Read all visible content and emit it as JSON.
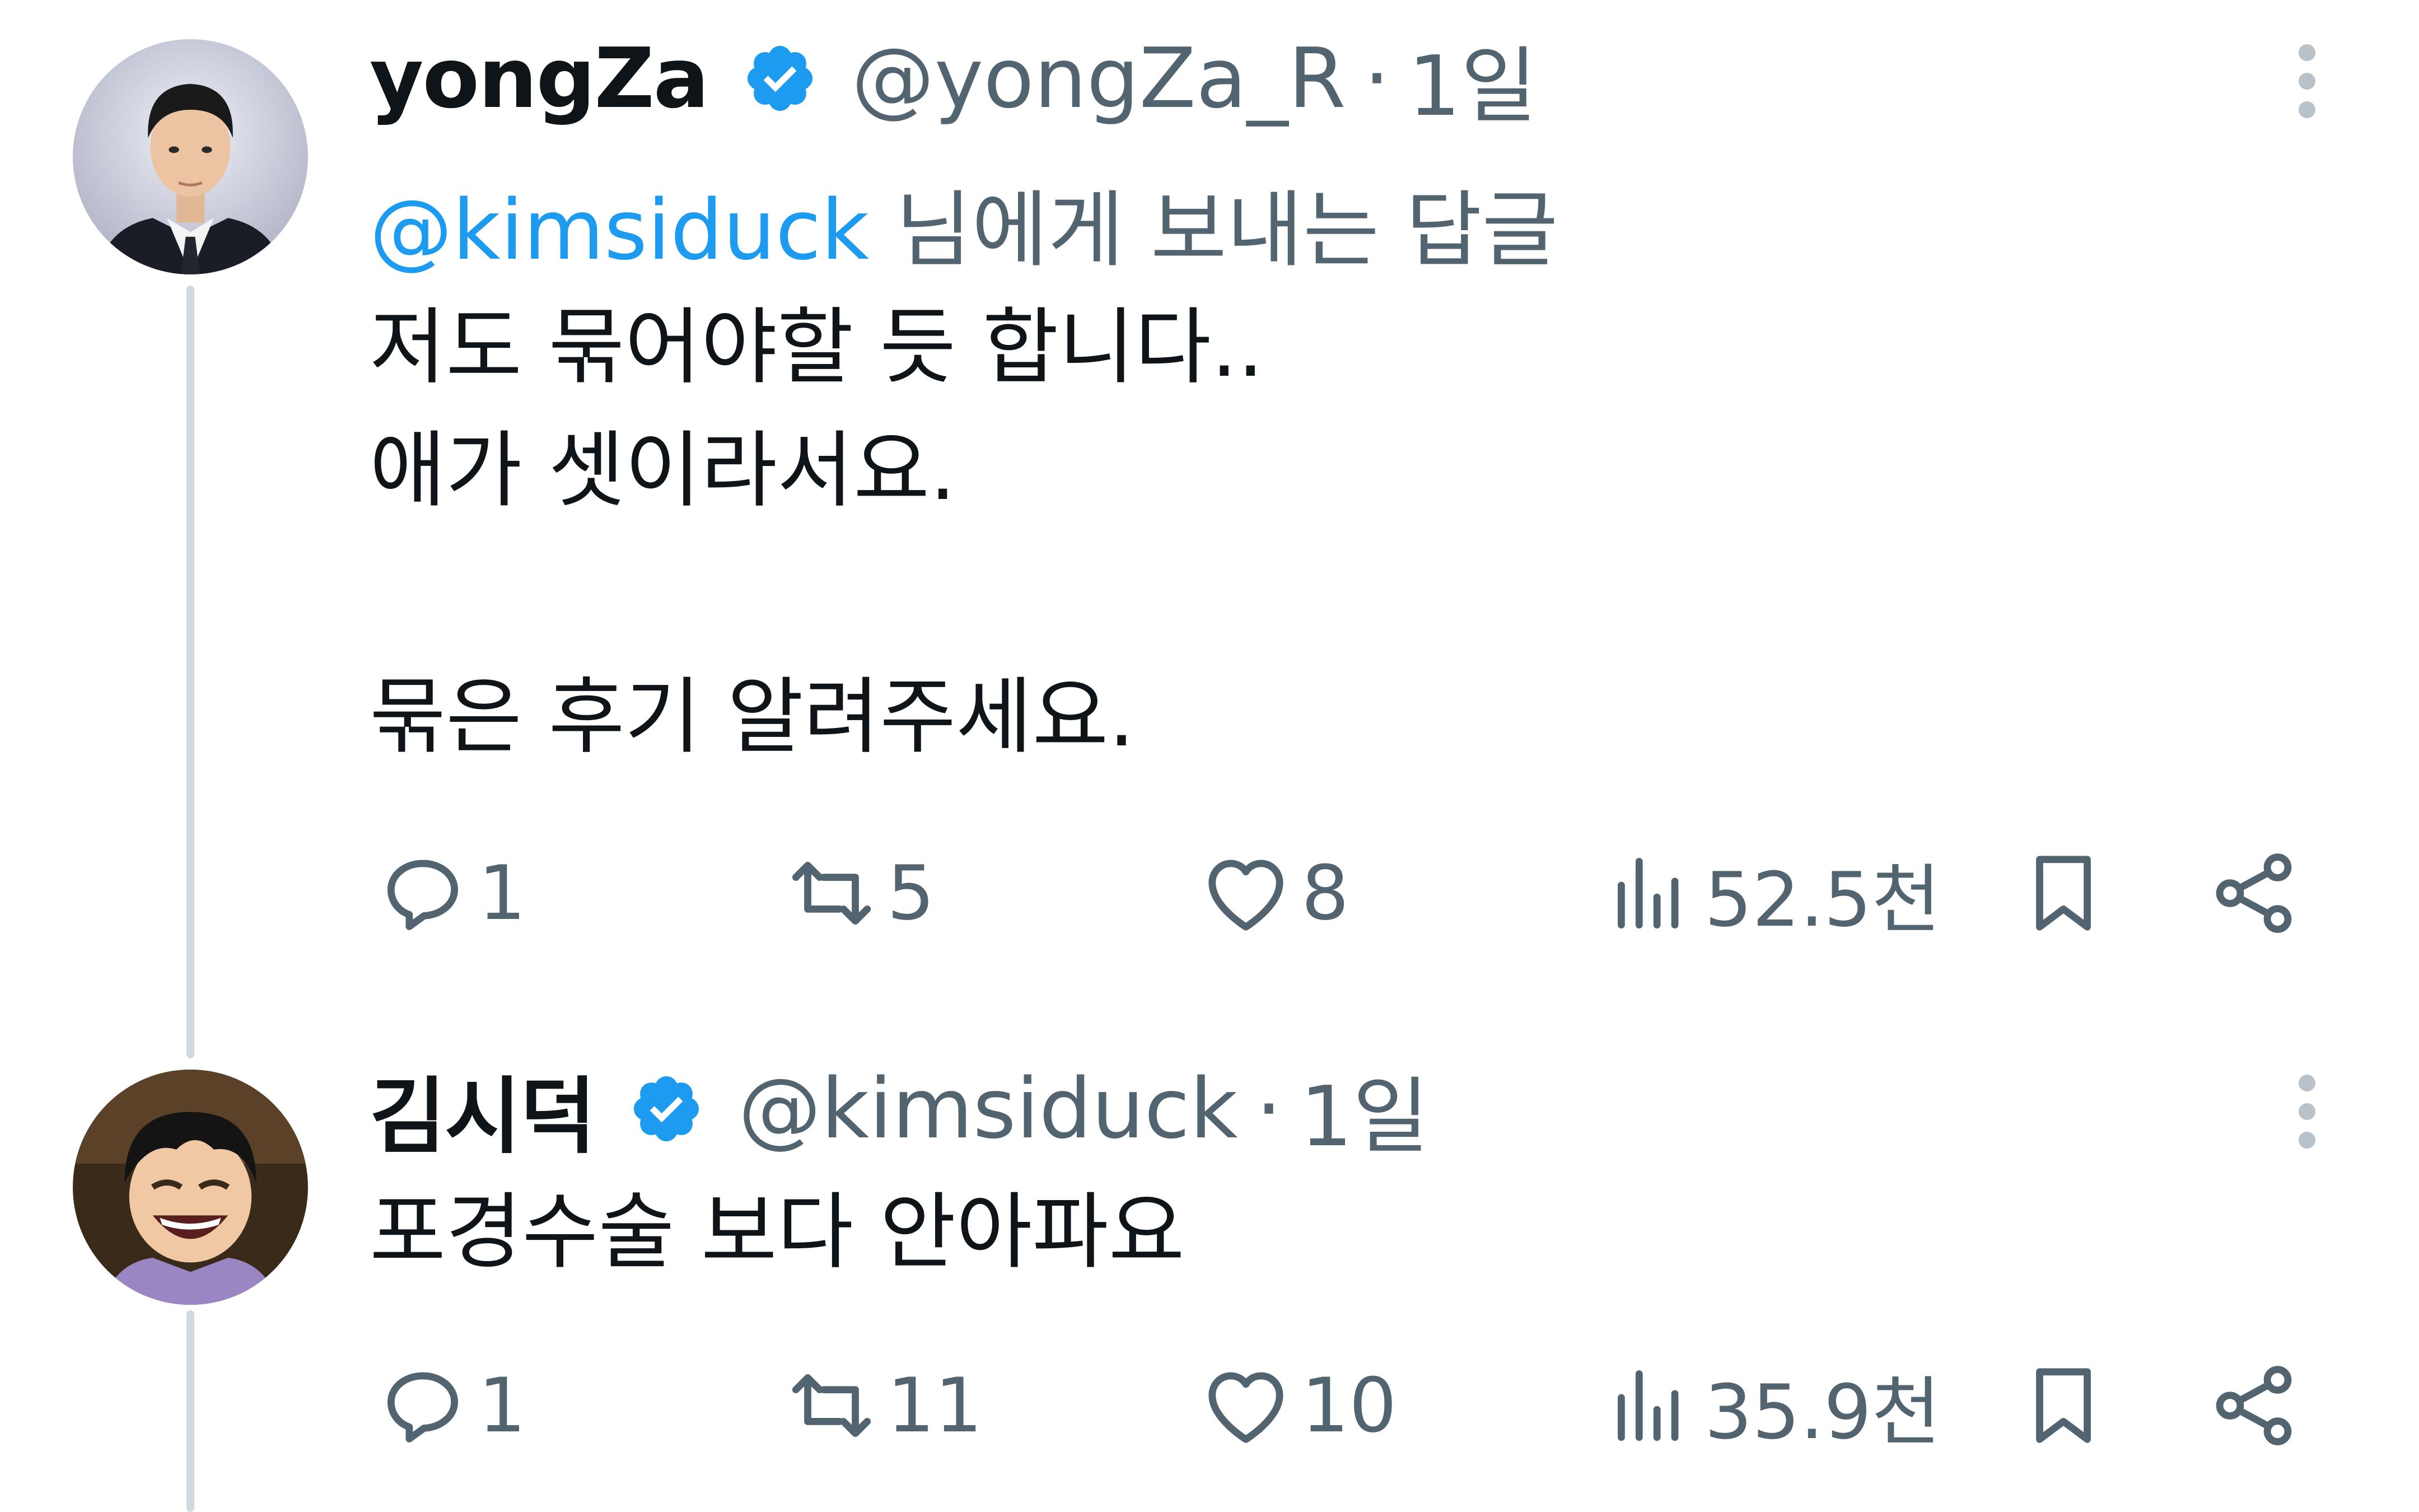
{
  "tweets": [
    {
      "name": "yongZa",
      "handle": "@yongZa_R",
      "separator": "·",
      "time": "1일",
      "reply_to": {
        "mention": "@kimsiduck",
        "suffix": " 님에게 보내는 답글"
      },
      "lines": [
        "저도 묶어야할 듯 합니다..",
        "애가 셋이라서요.",
        "",
        "묶은 후기 알려주세요."
      ],
      "metrics": {
        "replies": "1",
        "retweets": "5",
        "likes": "8",
        "views": "52.5천"
      }
    },
    {
      "name": "김시덕",
      "handle": "@kimsiduck",
      "separator": "·",
      "time": "1일",
      "lines": [
        "포경수술 보다 안아파요"
      ],
      "metrics": {
        "replies": "1",
        "retweets": "11",
        "likes": "10",
        "views": "35.9천"
      }
    }
  ],
  "icons": {
    "reply": "reply-icon",
    "retweet": "retweet-icon",
    "like": "heart-icon",
    "views": "views-bar-chart-icon",
    "bookmark": "bookmark-icon",
    "share": "share-icon",
    "more": "more-vertical-icon",
    "verified": "verified-badge-icon"
  },
  "colors": {
    "accent": "#1d9bf0",
    "text": "#0f1419",
    "muted": "#536471",
    "thread_line": "#cfd9de"
  }
}
